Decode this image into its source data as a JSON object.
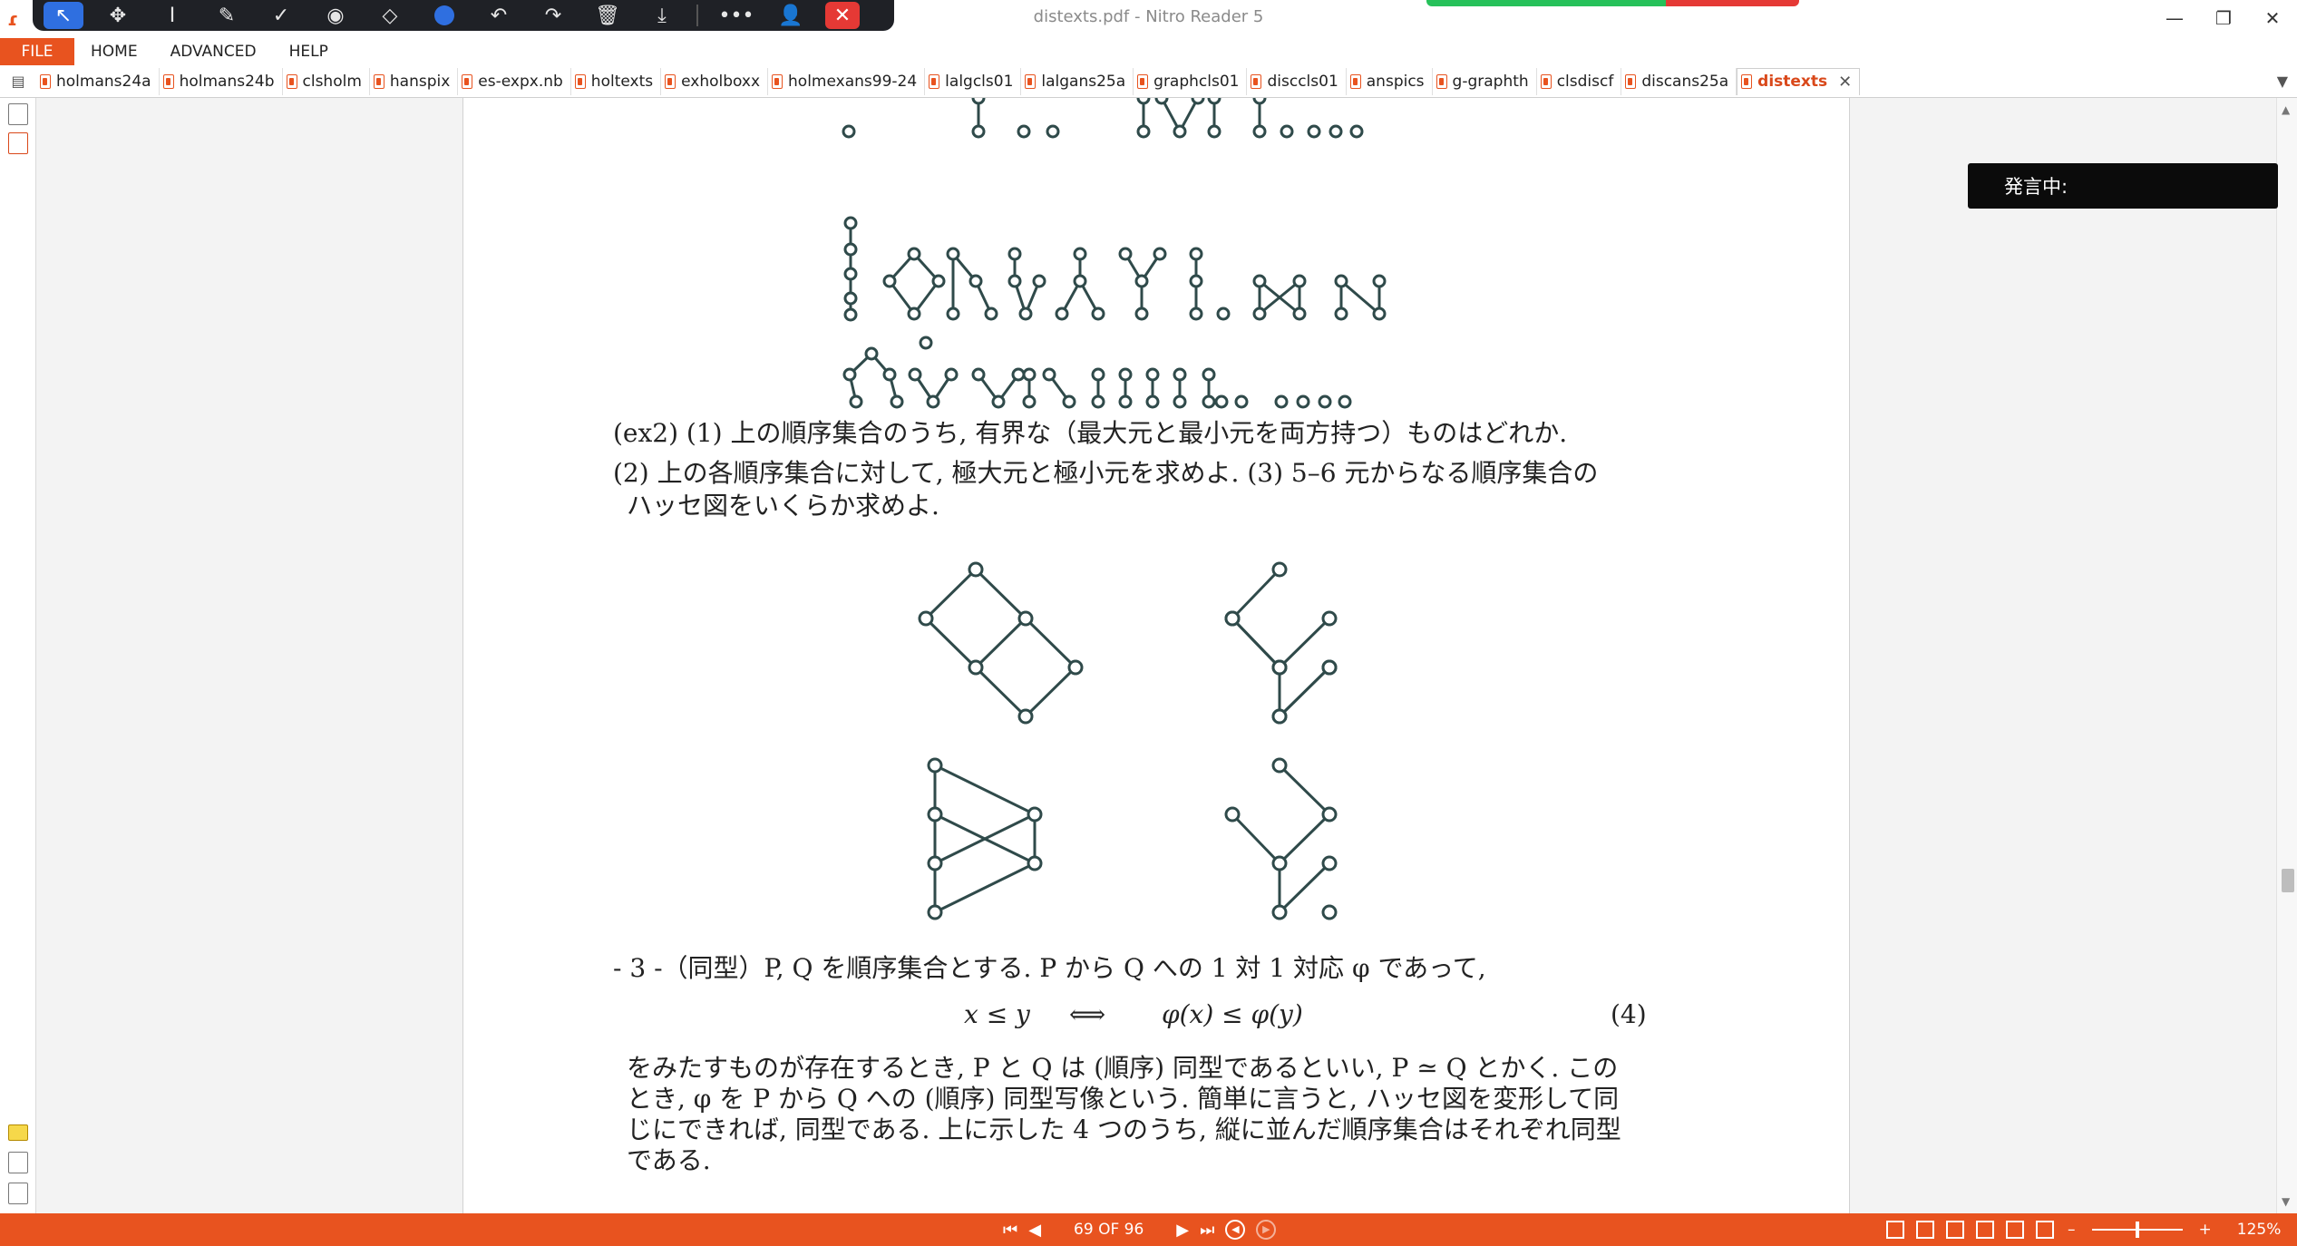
{
  "window": {
    "title": "distexts.pdf - Nitro Reader 5",
    "minimize": "—",
    "maximize": "❐",
    "close": "✕"
  },
  "float_toolbar": {
    "tools": [
      "select",
      "pan",
      "text-select",
      "draw",
      "check",
      "stamp",
      "eraser",
      "color",
      "undo",
      "redo",
      "delete",
      "download",
      "more",
      "user-settings",
      "close"
    ]
  },
  "menu": {
    "items": [
      "FILE",
      "HOME",
      "ADVANCED",
      "HELP"
    ]
  },
  "tabs": {
    "items": [
      "holmans24a",
      "holmans24b",
      "clsholm",
      "hanspix",
      "es-expx.nb",
      "holtexts",
      "exholboxx",
      "holmexans99-24",
      "lalgcls01",
      "lalgans25a",
      "graphcls01",
      "disccls01",
      "anspics",
      "g-graphth",
      "clsdiscf",
      "discans25a"
    ],
    "active": "distexts",
    "close": "✕"
  },
  "speaking": {
    "label": "発言中:"
  },
  "document": {
    "ex2_line1": "(ex2) (1) 上の順序集合のうち, 有界な（最大元と最小元を両方持つ）ものはどれか.",
    "ex2_line2": "(2) 上の各順序集合に対して, 極大元と極小元を求めよ.   (3) 5–6 元からなる順序集合の",
    "ex2_line3": "ハッセ図をいくらか求めよ.",
    "sec3_intro": "- 3 -（同型）P, Q を順序集合とする. P から Q への 1 対 1 対応 φ であって,",
    "eq_left": "x ≤ y",
    "eq_arrow": "⟺",
    "eq_right": "φ(x) ≤ φ(y)",
    "eq_number": "(4)",
    "para_line1": "をみたすものが存在するとき, P と Q は (順序) 同型であるといい, P ≃ Q とかく. この",
    "para_line2": "とき, φ を P から Q への (順序) 同型写像という. 簡単に言うと, ハッセ図を変形して同",
    "para_line3": "じにできれば, 同型である. 上に示した 4 つのうち, 縦に並んだ順序集合はそれぞれ同型",
    "para_line4": "である."
  },
  "status": {
    "page_indicator": "69 OF 96",
    "zoom": "125%",
    "zoom_minus": "–",
    "zoom_plus": "+"
  },
  "colors": {
    "accent": "#e8531f",
    "graph_stroke": "#2f4a4a",
    "toolbar_bg": "#1f2126",
    "active_tool": "#2f6fe0"
  }
}
